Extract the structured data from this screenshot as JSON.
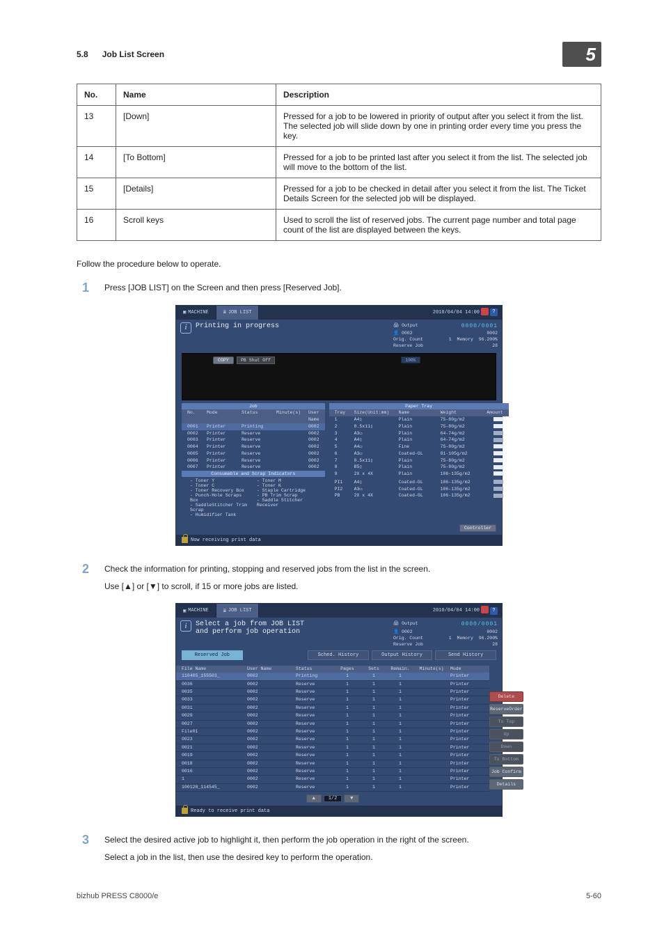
{
  "header": {
    "section_num": "5.8",
    "section_title": "Job List Screen",
    "chapter": "5"
  },
  "table": {
    "headers": {
      "no": "No.",
      "name": "Name",
      "desc": "Description"
    },
    "rows": [
      {
        "no": "13",
        "name": "[Down]",
        "desc": "Pressed for a job to be lowered in priority of output after you select it from the list. The selected job will slide down by one in printing order every time you press the key."
      },
      {
        "no": "14",
        "name": "[To Bottom]",
        "desc": "Pressed for a job to be printed last after you select it from the list. The selected job will move to the bottom of the list."
      },
      {
        "no": "15",
        "name": "[Details]",
        "desc": "Pressed for a job to be checked in detail after you select it from the list. The Ticket Details Screen for the selected job will be displayed."
      },
      {
        "no": "16",
        "name": "Scroll keys",
        "desc": "Used to scroll the list of reserved jobs. The current page number and total page count of the list are displayed between the keys."
      }
    ]
  },
  "lead": "Follow the procedure below to operate.",
  "steps": {
    "s1": {
      "n": "1",
      "text": "Press [JOB LIST] on the Screen and then press [Reserved Job]."
    },
    "s2": {
      "n": "2",
      "text": "Check the information for printing, stopping and reserved jobs from the list in the screen.",
      "sub": "Use [▲] or [▼] to scroll, if 15 or more jobs are listed."
    },
    "s3": {
      "n": "3",
      "text": "Select the desired active job to highlight it, then perform the job operation in the right of the screen.",
      "sub": "Select a job in the list, then use the desired key to perform the operation."
    }
  },
  "shot_common": {
    "tab_machine": "MACHINE",
    "tab_joblist": "JOB LIST",
    "datetime": "2010/04/04 14:00",
    "meters": {
      "output_lbl": "Output",
      "output_val": "0000/0001",
      "user_lbl": "0002",
      "user_count": "0002",
      "orig_lbl": "Orig. Count",
      "orig_val": "1",
      "mem_lbl": "Memory",
      "mem_val": "96.200%",
      "res_lbl": "Reserve Job",
      "res_val": "28"
    },
    "help": "?"
  },
  "shot1": {
    "title": "Printing in progress",
    "pb_btn": "PB Shut Off",
    "copy_btn": "COPY",
    "meter_val": "100%",
    "job_tab": "Job",
    "tray_tab": "Paper Tray",
    "job_head": {
      "no": "No.",
      "mode": "Mode",
      "status": "Status",
      "min": "Minute(s)",
      "user": "User Name"
    },
    "jobs": [
      {
        "no": "0001",
        "mode": "Printer",
        "status": "Printing",
        "min": "",
        "user": "0002"
      },
      {
        "no": "0002",
        "mode": "Printer",
        "status": "Reserve",
        "min": "",
        "user": "0002"
      },
      {
        "no": "0003",
        "mode": "Printer",
        "status": "Reserve",
        "min": "",
        "user": "0002"
      },
      {
        "no": "0004",
        "mode": "Printer",
        "status": "Reserve",
        "min": "",
        "user": "0002"
      },
      {
        "no": "0005",
        "mode": "Printer",
        "status": "Reserve",
        "min": "",
        "user": "0002"
      },
      {
        "no": "0006",
        "mode": "Printer",
        "status": "Reserve",
        "min": "",
        "user": "0002"
      },
      {
        "no": "0007",
        "mode": "Printer",
        "status": "Reserve",
        "min": "",
        "user": "0002"
      }
    ],
    "tray_head": {
      "tray": "Tray",
      "size": "Size(Unit:mm)",
      "name": "Name",
      "weight": "Weight",
      "amount": "Amount"
    },
    "trays": [
      {
        "t": "1",
        "s": "A4▯",
        "n": "Plain",
        "w": "75-80g/m2",
        "sw": "sw-white"
      },
      {
        "t": "2",
        "s": "8.5x11▯",
        "n": "Plain",
        "w": "75-80g/m2",
        "sw": "sw-white"
      },
      {
        "t": "3",
        "s": "A3▭",
        "n": "Plain",
        "w": "64-74g/m2",
        "sw": "sw-grey"
      },
      {
        "t": "4",
        "s": "A4▯",
        "n": "Plain",
        "w": "64-74g/m2",
        "sw": "sw-grey"
      },
      {
        "t": "5",
        "s": "A4▭",
        "n": "Fine",
        "w": "75-80g/m2",
        "sw": "sw-white"
      },
      {
        "t": "6",
        "s": "A3▭",
        "n": "Coated-GL",
        "w": "81-105g/m2",
        "sw": "sw-white"
      },
      {
        "t": "7",
        "s": "8.5x11▯",
        "n": "Plain",
        "w": "75-80g/m2",
        "sw": "sw-white"
      },
      {
        "t": "8",
        "s": "B5▯",
        "n": "Plain",
        "w": "75-80g/m2",
        "sw": "sw-white"
      },
      {
        "t": "9",
        "s": "2X x 4X",
        "n": "Plain",
        "w": "106-135g/m2",
        "sw": "sw-white"
      }
    ],
    "consumable_hdr": "Consumable and Scrap Indicators",
    "consumables": {
      "c1": [
        "Toner Y",
        "Toner C",
        "Toner Recovery Box",
        "Punch-Hole Scraps Box",
        "SaddleStitcher Trim Scrap",
        "Humidifier Tank"
      ],
      "c2": [
        "Toner M",
        "Toner K",
        "Staple Cartridge",
        "PB Trim Scrap",
        "Saddle Stitcher Receiver"
      ]
    },
    "pi": [
      {
        "t": "PI1",
        "s": "A4▯",
        "n": "Coated-GL",
        "w": "106-135g/m2"
      },
      {
        "t": "PI2",
        "s": "A3▭",
        "n": "Coated-GL",
        "w": "106-135g/m2"
      },
      {
        "t": "PB",
        "s": "2X x 4X",
        "n": "Coated-GL",
        "w": "106-135g/m2"
      }
    ],
    "controller_btn": "Controller",
    "footer": "Now receiving print data"
  },
  "shot2": {
    "title": "Select a job from JOB LIST\nand perform job operation",
    "tabs": {
      "reserved": "Reserved Job",
      "sched": "Sched. History",
      "out": "Output History",
      "send": "Send History"
    },
    "head": {
      "file": "File Name",
      "user": "User Name",
      "status": "Status",
      "pages": "Pages",
      "sets": "Sets",
      "remain": "Remain.",
      "min": "Minute(s)",
      "mode": "Mode"
    },
    "rows": [
      {
        "f": "110405_155503_",
        "u": "0002",
        "st": "Printing",
        "p": "1",
        "s": "1",
        "r": "1",
        "m": "",
        "md": "Printer"
      },
      {
        "f": "0036",
        "u": "0002",
        "st": "Reserve",
        "p": "1",
        "s": "1",
        "r": "1",
        "m": "",
        "md": "Printer"
      },
      {
        "f": "0035",
        "u": "0002",
        "st": "Reserve",
        "p": "1",
        "s": "1",
        "r": "1",
        "m": "",
        "md": "Printer"
      },
      {
        "f": "0033",
        "u": "0002",
        "st": "Reserve",
        "p": "1",
        "s": "1",
        "r": "1",
        "m": "",
        "md": "Printer"
      },
      {
        "f": "0031",
        "u": "0002",
        "st": "Reserve",
        "p": "1",
        "s": "1",
        "r": "1",
        "m": "",
        "md": "Printer"
      },
      {
        "f": "0029",
        "u": "0002",
        "st": "Reserve",
        "p": "1",
        "s": "1",
        "r": "1",
        "m": "",
        "md": "Printer"
      },
      {
        "f": "0027",
        "u": "0002",
        "st": "Reserve",
        "p": "1",
        "s": "1",
        "r": "1",
        "m": "",
        "md": "Printer"
      },
      {
        "f": "File01",
        "u": "0002",
        "st": "Reserve",
        "p": "1",
        "s": "1",
        "r": "1",
        "m": "",
        "md": "Printer"
      },
      {
        "f": "0023",
        "u": "0002",
        "st": "Reserve",
        "p": "1",
        "s": "1",
        "r": "1",
        "m": "",
        "md": "Printer"
      },
      {
        "f": "0021",
        "u": "0002",
        "st": "Reserve",
        "p": "1",
        "s": "1",
        "r": "1",
        "m": "",
        "md": "Printer"
      },
      {
        "f": "0019",
        "u": "0002",
        "st": "Reserve",
        "p": "1",
        "s": "1",
        "r": "1",
        "m": "",
        "md": "Printer"
      },
      {
        "f": "0018",
        "u": "0002",
        "st": "Reserve",
        "p": "1",
        "s": "1",
        "r": "1",
        "m": "",
        "md": "Printer"
      },
      {
        "f": "0016",
        "u": "0002",
        "st": "Reserve",
        "p": "1",
        "s": "1",
        "r": "1",
        "m": "",
        "md": "Printer"
      },
      {
        "f": "1",
        "u": "0002",
        "st": "Reserve",
        "p": "1",
        "s": "1",
        "r": "1",
        "m": "",
        "md": "Printer"
      },
      {
        "f": "100128_114545_",
        "u": "0002",
        "st": "Reserve",
        "p": "1",
        "s": "1",
        "r": "1",
        "m": "",
        "md": "Printer"
      }
    ],
    "btns": {
      "delete": "Delete",
      "reserve": "ReserveOrder",
      "totop": "To Top",
      "up": "Up",
      "down": "Down",
      "tobottom": "To Bottom",
      "confirm": "Job Confirm",
      "details": "Details"
    },
    "pager": "1/2",
    "footer": "Ready to receive print data"
  },
  "footer": {
    "left": "bizhub PRESS C8000/e",
    "right": "5-60"
  }
}
